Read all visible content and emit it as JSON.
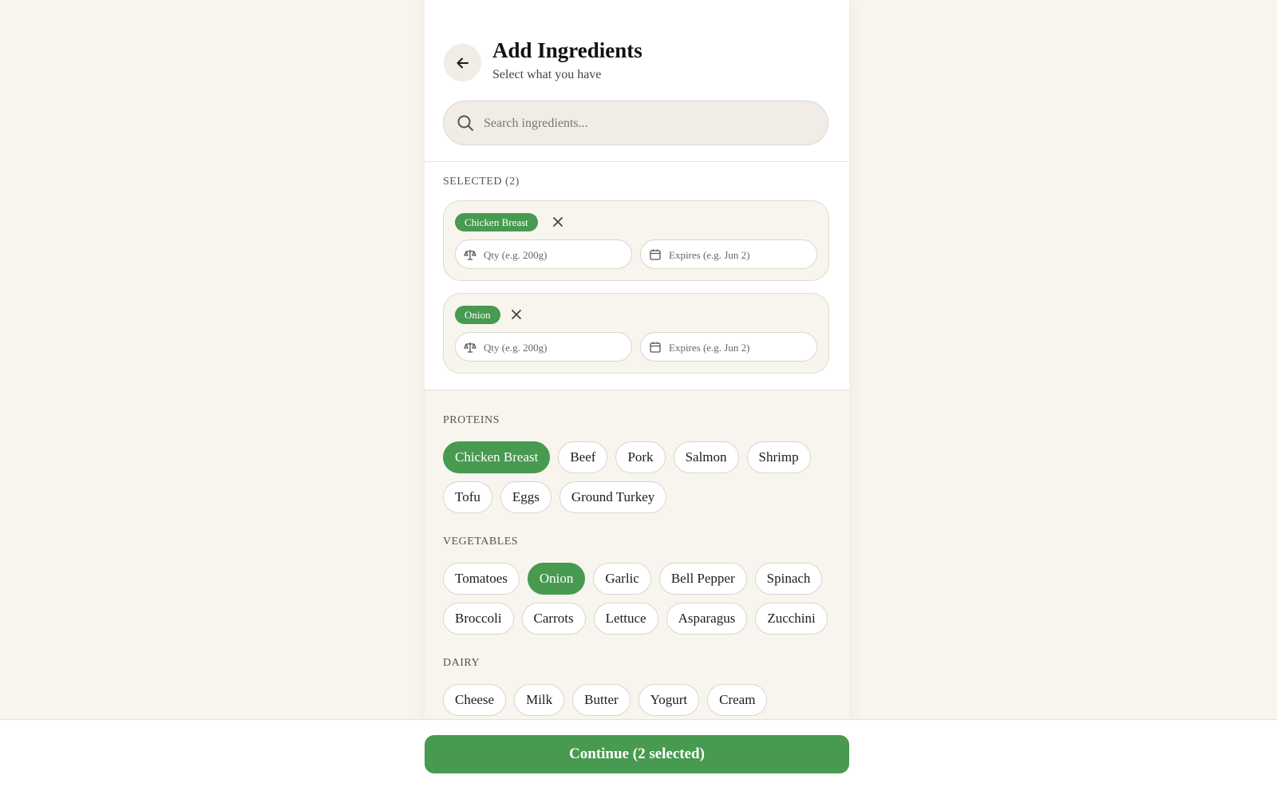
{
  "header": {
    "back_icon": "arrow-left-icon",
    "title": "Add Ingredients",
    "subtitle": "Select what you have"
  },
  "search": {
    "icon": "search-icon",
    "placeholder": "Search ingredients...",
    "value": ""
  },
  "selected": {
    "label": "SELECTED (2)",
    "items": [
      {
        "name": "Chicken Breast",
        "qty_placeholder": "Qty (e.g. 200g)",
        "expires_placeholder": "Expires (e.g. Jun 2)"
      },
      {
        "name": "Onion",
        "qty_placeholder": "Qty (e.g. 200g)",
        "expires_placeholder": "Expires (e.g. Jun 2)"
      }
    ]
  },
  "categories": [
    {
      "label": "PROTEINS",
      "items": [
        {
          "name": "Chicken Breast",
          "selected": true
        },
        {
          "name": "Beef",
          "selected": false
        },
        {
          "name": "Pork",
          "selected": false
        },
        {
          "name": "Salmon",
          "selected": false
        },
        {
          "name": "Shrimp",
          "selected": false
        },
        {
          "name": "Tofu",
          "selected": false
        },
        {
          "name": "Eggs",
          "selected": false
        },
        {
          "name": "Ground Turkey",
          "selected": false
        }
      ]
    },
    {
      "label": "VEGETABLES",
      "items": [
        {
          "name": "Tomatoes",
          "selected": false
        },
        {
          "name": "Onion",
          "selected": true
        },
        {
          "name": "Garlic",
          "selected": false
        },
        {
          "name": "Bell Pepper",
          "selected": false
        },
        {
          "name": "Spinach",
          "selected": false
        },
        {
          "name": "Broccoli",
          "selected": false
        },
        {
          "name": "Carrots",
          "selected": false
        },
        {
          "name": "Lettuce",
          "selected": false
        },
        {
          "name": "Asparagus",
          "selected": false
        },
        {
          "name": "Zucchini",
          "selected": false
        }
      ]
    },
    {
      "label": "DAIRY",
      "items": [
        {
          "name": "Cheese",
          "selected": false
        },
        {
          "name": "Milk",
          "selected": false
        },
        {
          "name": "Butter",
          "selected": false
        },
        {
          "name": "Yogurt",
          "selected": false
        },
        {
          "name": "Cream",
          "selected": false
        }
      ]
    }
  ],
  "footer": {
    "continue_label": "Continue (2 selected)"
  },
  "colors": {
    "accent": "#479a4f",
    "background": "#f8f4ee",
    "surface": "#ffffff",
    "field": "#f1ece5"
  }
}
